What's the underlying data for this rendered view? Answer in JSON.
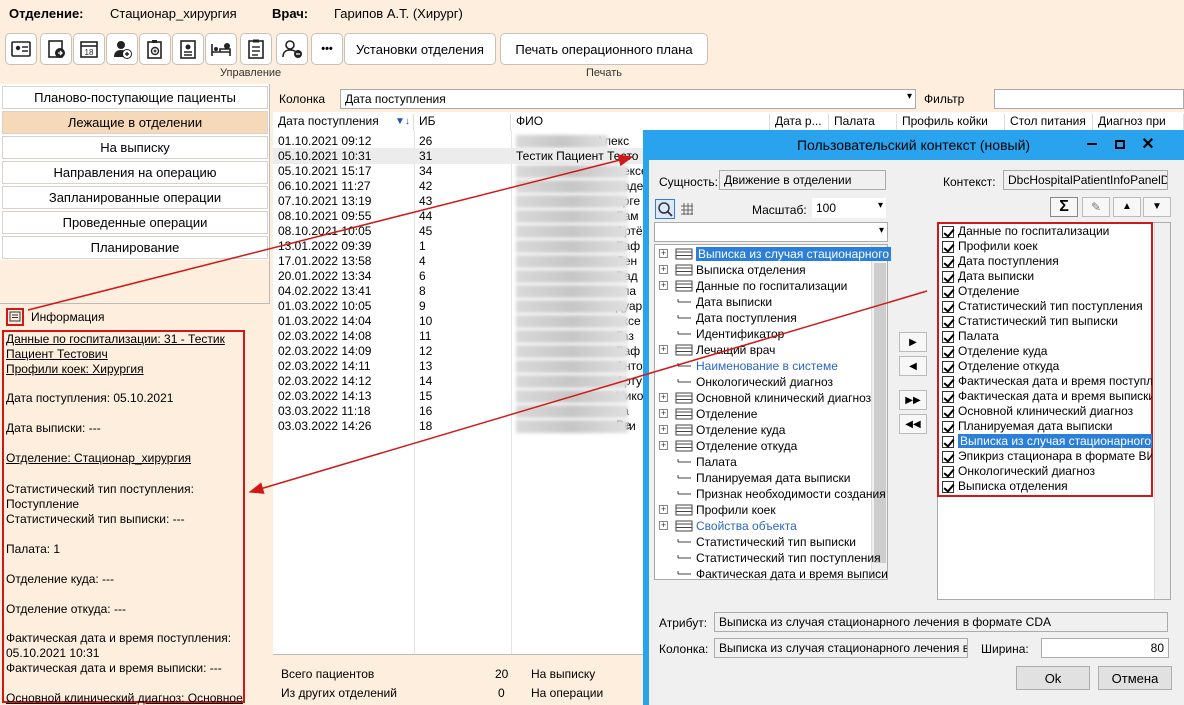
{
  "header": {
    "dept_label": "Отделение:",
    "dept_value": "Стационар_хирургия",
    "doctor_label": "Врач:",
    "doctor_value": "Гарипов А.Т. (Хирург)"
  },
  "toolbar": {
    "icons": [
      "id-card-icon",
      "import-document-icon",
      "calendar-18-icon",
      "doctor-add-icon",
      "clipboard-add-icon",
      "badge-icon",
      "bed-icon",
      "checklist-icon",
      "person-add-icon"
    ],
    "more_label": "•••",
    "dept_settings_label": "Установки отделения",
    "print_plan_label": "Печать операционного плана",
    "group_manage": "Управление",
    "group_print": "Печать"
  },
  "nav": {
    "items": [
      {
        "label": "Планово-поступающие пациенты"
      },
      {
        "label": "Лежащие в отделении",
        "active": true
      },
      {
        "label": "На выписку"
      },
      {
        "label": "Направления на операцию"
      },
      {
        "label": "Запланированные операции"
      },
      {
        "label": "Проведенные операции"
      },
      {
        "label": "Планирование"
      }
    ]
  },
  "info": {
    "title": "Информация",
    "lines": [
      {
        "text": "Данные по госпитализации: 31 - Тестик",
        "u": true
      },
      {
        "text": "Пациент Тестович",
        "u": true
      },
      {
        "text": "Профили коек: Хирургия",
        "u": true
      },
      {
        "text": "Дата поступления: 05.10.2021"
      },
      {
        "text": "Дата выписки: ---"
      },
      {
        "text": "Отделение: Стационар_хирургия",
        "u": true
      },
      {
        "text": "Статистический тип поступления:"
      },
      {
        "text": "Поступление"
      },
      {
        "text": "Статистический тип выписки: ---"
      },
      {
        "text": "Палата: 1"
      },
      {
        "text": "Отделение куда: ---"
      },
      {
        "text": "Отделение откуда: ---"
      },
      {
        "text": "Фактическая дата и время поступления:"
      },
      {
        "text": "05.10.2021 10:31"
      },
      {
        "text": "Фактическая дата и время выписки: ---"
      },
      {
        "text": "Основной клинический диагноз: Основное",
        "u": true
      }
    ]
  },
  "filter": {
    "column_label": "Колонка",
    "column_value": "Дата поступления",
    "filter_label": "Фильтр",
    "filter_value": ""
  },
  "grid": {
    "columns": [
      "Дата поступления",
      "ИБ",
      "ФИО",
      "Дата р...",
      "Палата",
      "Профиль койки",
      "Стол питания",
      "Диагноз при"
    ],
    "rows": [
      {
        "date": "01.10.2021 09:12",
        "ib": "26",
        "fio": "Алекс"
      },
      {
        "date": "05.10.2021 10:31",
        "ib": "31",
        "fio": "Тестик Пациент Тесто"
      },
      {
        "date": "05.10.2021 15:17",
        "ib": "34",
        "fio": "лексе"
      },
      {
        "date": "06.10.2021 11:27",
        "ib": "42",
        "fio": "ладе"
      },
      {
        "date": "07.10.2021 13:19",
        "ib": "43",
        "fio": "ерге"
      },
      {
        "date": "08.10.2021 09:55",
        "ib": "44",
        "fio": "Рам"
      },
      {
        "date": "08.10.2021 10:05",
        "ib": "45",
        "fio": "Артё"
      },
      {
        "date": "13.01.2022 09:39",
        "ib": "1",
        "fio": "Раф"
      },
      {
        "date": "17.01.2022 13:58",
        "ib": "4",
        "fio": "Лен"
      },
      {
        "date": "20.01.2022 13:34",
        "ib": "6",
        "fio": "Вад"
      },
      {
        "date": "04.02.2022 13:41",
        "ib": "8",
        "fio": "ола"
      },
      {
        "date": "01.03.2022 10:05",
        "ib": "9",
        "fio": "дуар"
      },
      {
        "date": "01.03.2022 14:04",
        "ib": "10",
        "fio": "ексе"
      },
      {
        "date": "02.03.2022 14:08",
        "ib": "11",
        "fio": "Газ"
      },
      {
        "date": "02.03.2022 14:09",
        "ib": "12",
        "fio": "Раф"
      },
      {
        "date": "02.03.2022 14:11",
        "ib": "13",
        "fio": "Анто"
      },
      {
        "date": "02.03.2022 14:12",
        "ib": "14",
        "fio": "Арту"
      },
      {
        "date": "02.03.2022 14:13",
        "ib": "15",
        "fio": "Нико"
      },
      {
        "date": "03.03.2022 11:18",
        "ib": "16",
        "fio": "ва Ве"
      },
      {
        "date": "03.03.2022 14:26",
        "ib": "18",
        "fio": "еви"
      }
    ]
  },
  "summary": {
    "total_label": "Всего пациентов",
    "total_value": "20",
    "discharge_label": "На выписку",
    "other_label": "Из других отделений",
    "other_value": "0",
    "operation_label": "На операции"
  },
  "dialog": {
    "title": "Пользовательский контекст (новый)",
    "entity_label": "Сущность:",
    "entity_value": "Движение в отделении",
    "scale_label": "Масштаб:",
    "scale_value": "100",
    "context_label": "Контекст:",
    "context_value": "DbcHospitalPatientInfoPanelDivisi",
    "tree": [
      {
        "label": "Выписка из случая стационарного",
        "plus": true,
        "icon": "table",
        "sel": true
      },
      {
        "label": "Выписка отделения",
        "plus": true,
        "icon": "table"
      },
      {
        "label": "Данные по госпитализации",
        "plus": true,
        "icon": "table"
      },
      {
        "label": "Дата выписки",
        "icon": "field"
      },
      {
        "label": "Дата поступления",
        "icon": "field"
      },
      {
        "label": "Идентификатор",
        "icon": "field"
      },
      {
        "label": "Лечащий врач",
        "plus": true,
        "icon": "table"
      },
      {
        "label": "Наименование в системе",
        "icon": "field",
        "blue": true
      },
      {
        "label": "Онкологический диагноз",
        "icon": "field"
      },
      {
        "label": "Основной клинический диагноз",
        "plus": true,
        "icon": "table"
      },
      {
        "label": "Отделение",
        "plus": true,
        "icon": "table"
      },
      {
        "label": "Отделение куда",
        "plus": true,
        "icon": "table"
      },
      {
        "label": "Отделение откуда",
        "plus": true,
        "icon": "table"
      },
      {
        "label": "Палата",
        "icon": "field"
      },
      {
        "label": "Планируемая дата выписки",
        "icon": "field"
      },
      {
        "label": "Признак необходимости создания",
        "icon": "field"
      },
      {
        "label": "Профили коек",
        "plus": true,
        "icon": "table"
      },
      {
        "label": "Свойства объекта",
        "plus": true,
        "icon": "table",
        "blue": true
      },
      {
        "label": "Статистический тип выписки",
        "icon": "field"
      },
      {
        "label": "Статистический тип поступления",
        "icon": "field"
      },
      {
        "label": "Фактическая дата и время выписи",
        "icon": "field"
      }
    ],
    "checked": [
      {
        "label": "Данные по госпитализации"
      },
      {
        "label": "Профили коек"
      },
      {
        "label": "Дата поступления"
      },
      {
        "label": "Дата выписки"
      },
      {
        "label": "Отделение"
      },
      {
        "label": "Статистический тип поступления"
      },
      {
        "label": "Статистический тип выписки"
      },
      {
        "label": "Палата"
      },
      {
        "label": "Отделение куда"
      },
      {
        "label": "Отделение откуда"
      },
      {
        "label": "Фактическая дата и время поступлен"
      },
      {
        "label": "Фактическая дата и время выписки"
      },
      {
        "label": "Основной клинический диагноз"
      },
      {
        "label": "Планируемая дата выписки"
      },
      {
        "label": "Выписка из случая стационарного леч",
        "sel": true
      },
      {
        "label": "Эпикриз стационара в формате ВИМИ"
      },
      {
        "label": "Онкологический диагноз"
      },
      {
        "label": "Выписка отделения"
      }
    ],
    "move_buttons": [
      "▶",
      "◀",
      "▶▶",
      "◀◀"
    ],
    "attribute_label": "Атрибут:",
    "attribute_value": "Выписка из случая стационарного лечения в формате CDA",
    "column_label": "Колонка:",
    "column_value": "Выписка из случая стационарного лечения в фор",
    "width_label": "Ширина:",
    "width_value": "80",
    "ok_label": "Ok",
    "cancel_label": "Отмена",
    "sigma": "Σ"
  },
  "colors": {
    "accent": "#29a3ee",
    "annotation": "#d01818",
    "panel_bg": "#fdeede",
    "active_tab": "#f6d9b8",
    "selection": "#2b7fd8"
  }
}
